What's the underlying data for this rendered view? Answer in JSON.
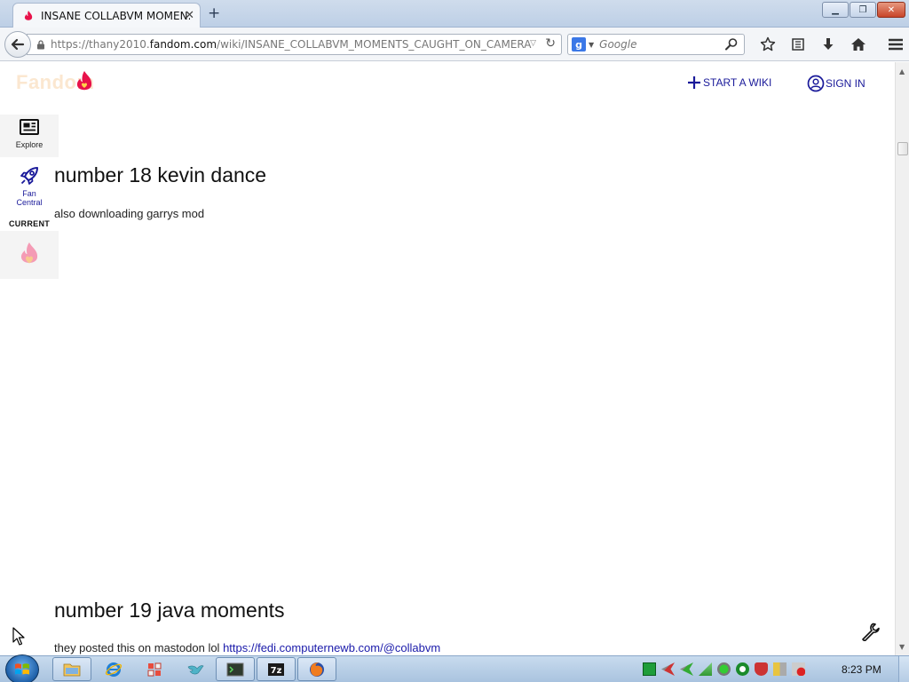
{
  "browser": {
    "tab_title": "INSANE COLLABVM MOMEN...",
    "url_prefix": "https://thany2010.",
    "url_domain": "fandom.com",
    "url_path": "/wiki/INSANE_COLLABVM_MOMENTS_CAUGHT_ON_CAMERA",
    "search_placeholder": "Google"
  },
  "header": {
    "logo_text": "Fandom",
    "start_wiki_label": "START A WIKI",
    "sign_in_label": "SIGN IN"
  },
  "rail": {
    "explore_label": "Explore",
    "fan_central_label_1": "Fan",
    "fan_central_label_2": "Central",
    "current_label": "CURRENT"
  },
  "content": {
    "section1_title": "number 18 kevin dance",
    "section1_text": "also downloading garrys mod",
    "section2_title": "number 19 java moments",
    "section2_text": "they posted this on mastodon lol ",
    "section2_link": "https://fedi.computernewb.com/@collabvm"
  },
  "taskbar": {
    "clock": "8:23 PM"
  },
  "colors": {
    "fandom_link": "#1a1a9a",
    "fandom_flame": "#e8124a"
  }
}
